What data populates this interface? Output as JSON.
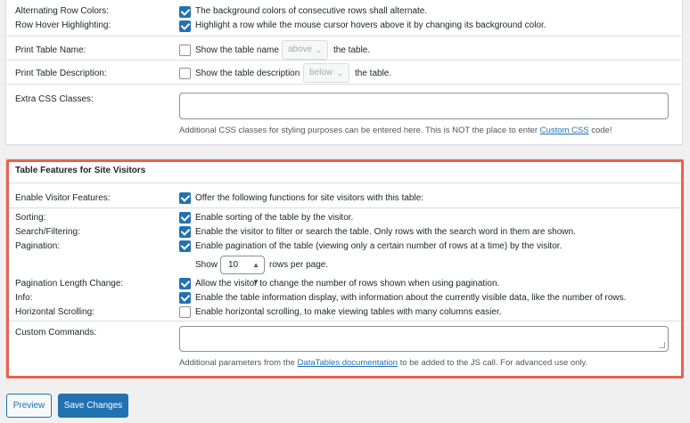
{
  "display_options": {
    "alternating_row_colors": {
      "label": "Alternating Row Colors:",
      "text": "The background colors of consecutive rows shall alternate.",
      "checked": true
    },
    "row_hover_highlighting": {
      "label": "Row Hover Highlighting:",
      "text": "Highlight a row while the mouse cursor hovers above it by changing its background color.",
      "checked": true
    },
    "print_table_name": {
      "label": "Print Table Name:",
      "text_before": "Show the table name",
      "select_value": "above",
      "text_after": "the table.",
      "checked": false
    },
    "print_table_description": {
      "label": "Print Table Description:",
      "text_before": "Show the table description",
      "select_value": "below",
      "text_after": "the table.",
      "checked": false
    },
    "extra_css_classes": {
      "label": "Extra CSS Classes:",
      "value": "",
      "help_before": "Additional CSS classes for styling purposes can be entered here. This is NOT the place to enter",
      "help_link": "Custom CSS",
      "help_after": "code!"
    }
  },
  "visitor_features": {
    "heading": "Table Features for Site Visitors",
    "enable_visitor_features": {
      "label": "Enable Visitor Features:",
      "text": "Offer the following functions for site visitors with this table:",
      "checked": true
    },
    "sorting": {
      "label": "Sorting:",
      "text": "Enable sorting of the table by the visitor.",
      "checked": true
    },
    "search_filtering": {
      "label": "Search/Filtering:",
      "text": "Enable the visitor to filter or search the table. Only rows with the search word in them are shown.",
      "checked": true
    },
    "pagination": {
      "label": "Pagination:",
      "text": "Enable pagination of the table (viewing only a certain number of rows at a time) by the visitor.",
      "checked": true,
      "show_label": "Show",
      "rows_value": "10",
      "rows_suffix": "rows per page."
    },
    "pagination_length_change": {
      "label": "Pagination Length Change:",
      "text": "Allow the visitor to change the number of rows shown when using pagination.",
      "checked": true
    },
    "info": {
      "label": "Info:",
      "text": "Enable the table information display, with information about the currently visible data, like the number of rows.",
      "checked": true
    },
    "horizontal_scrolling": {
      "label": "Horizontal Scrolling:",
      "text": "Enable horizontal scrolling, to make viewing tables with many columns easier.",
      "checked": false
    },
    "custom_commands": {
      "label": "Custom Commands:",
      "value": "",
      "help_before": "Additional parameters from the",
      "help_link": "DataTables documentation",
      "help_after": "to be added to the JS call. For advanced use only."
    }
  },
  "actions": {
    "preview_label": "Preview",
    "save_label": "Save Changes"
  },
  "colors": {
    "accent": "#2271b1",
    "highlight_border": "#e8624f",
    "background": "#f0f0f1"
  }
}
